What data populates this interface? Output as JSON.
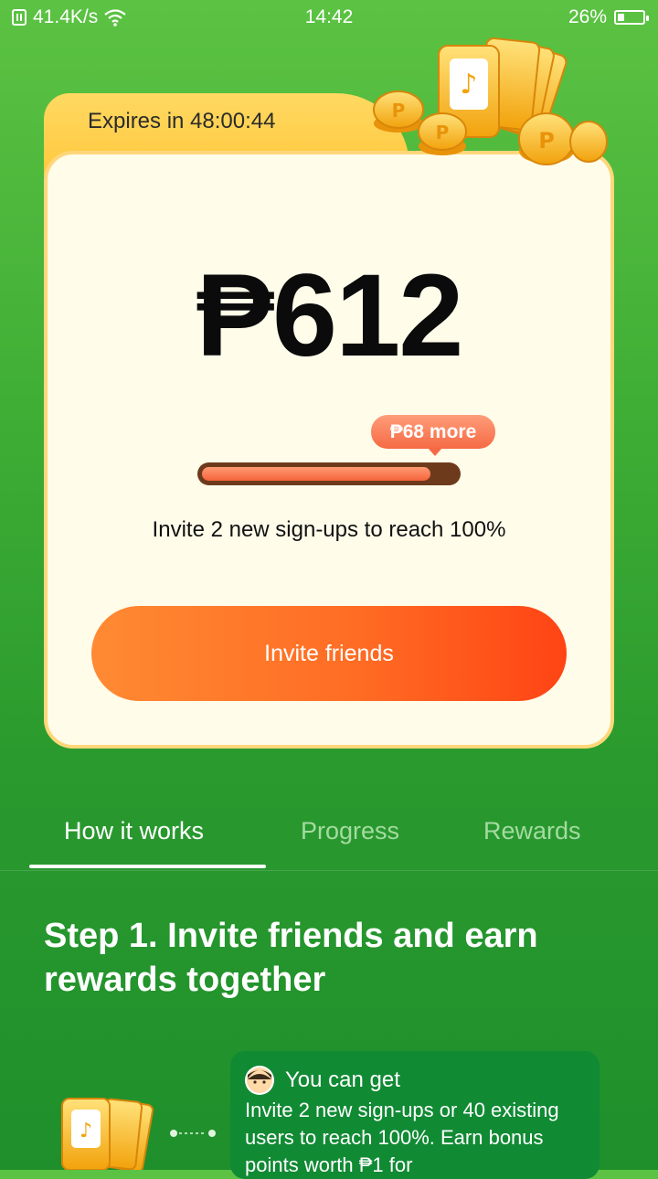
{
  "status_bar": {
    "network_speed": "41.4K/s",
    "time": "14:42",
    "battery": "26%"
  },
  "reward_card": {
    "expires": "Expires in 48:00:44",
    "amount": "₱612",
    "bubble": "₱68 more",
    "progress_fraction": 0.9,
    "invite_text": "Invite 2 new sign-ups to reach 100%",
    "invite_button": "Invite friends"
  },
  "tabs": [
    {
      "label": "How it works",
      "active": true
    },
    {
      "label": "Progress",
      "active": false
    },
    {
      "label": "Rewards",
      "active": false
    }
  ],
  "step": {
    "title": "Step 1. Invite friends and earn rewards together",
    "info_title": "You can get",
    "info_body": "Invite 2 new sign-ups or 40 existing users to reach 100%. Earn bonus points worth ₱1 for"
  },
  "colors": {
    "green": "#3fae35",
    "accent_orange": "#ff6d24",
    "card_bg": "#fffcea",
    "tab_gold": "#ffd962"
  }
}
